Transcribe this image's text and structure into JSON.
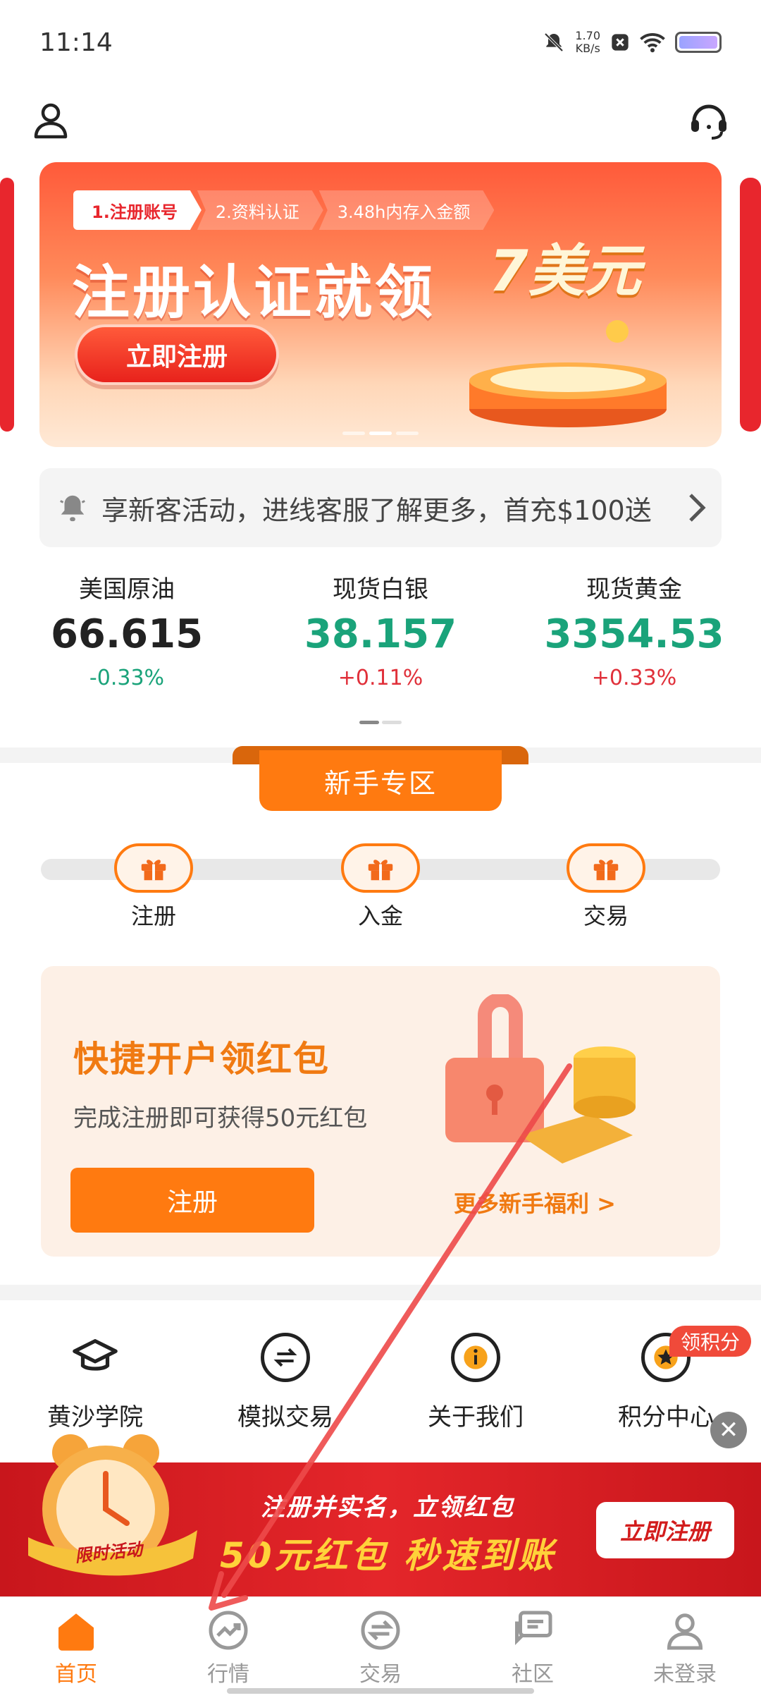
{
  "status_bar": {
    "time": "11:14",
    "net_speed_value": "1.70",
    "net_speed_unit": "KB/s"
  },
  "header": {
    "left_icon": "user-icon",
    "right_icon": "headset-icon"
  },
  "banner": {
    "steps": [
      "1.注册账号",
      "2.资料认证",
      "3.48h内存入金额"
    ],
    "title": "注册认证就领",
    "amount": "7美元",
    "button": "立即注册"
  },
  "notice": {
    "text": "享新客活动，进线客服了解更多，首充$100送"
  },
  "quotes": [
    {
      "name": "美国原油",
      "price": "66.615",
      "change": "-0.33%",
      "price_color": "#222222",
      "change_color": "#1aa37a"
    },
    {
      "name": "现货白银",
      "price": "38.157",
      "change": "+0.11%",
      "price_color": "#1aa37a",
      "change_color": "#e0303a"
    },
    {
      "name": "现货黄金",
      "price": "3354.53",
      "change": "+0.33%",
      "price_color": "#1aa37a",
      "change_color": "#e0303a"
    }
  ],
  "newbie": {
    "title": "新手专区",
    "milestones": [
      "注册",
      "入金",
      "交易"
    ],
    "promo": {
      "title": "快捷开户领红包",
      "subtitle": "完成注册即可获得50元红包",
      "button": "注册",
      "more": "更多新手福利 >"
    }
  },
  "quick_links": [
    {
      "label": "黄沙学院",
      "icon": "graduation-cap-icon"
    },
    {
      "label": "模拟交易",
      "icon": "exchange-icon"
    },
    {
      "label": "关于我们",
      "icon": "info-icon"
    },
    {
      "label": "积分中心",
      "icon": "star-icon"
    }
  ],
  "points_badge": "领积分",
  "ad": {
    "badge": "限时活动",
    "line1": "注册并实名，立领红包",
    "line2": "50元红包  秒速到账",
    "button": "立即注册"
  },
  "bottom_nav": [
    {
      "label": "首页",
      "icon": "home-icon",
      "active": true
    },
    {
      "label": "行情",
      "icon": "chart-trend-icon",
      "active": false
    },
    {
      "label": "交易",
      "icon": "exchange-icon",
      "active": false
    },
    {
      "label": "社区",
      "icon": "chat-icon",
      "active": false
    },
    {
      "label": "未登录",
      "icon": "user-icon",
      "active": false
    }
  ],
  "colors": {
    "accent": "#ff7a10",
    "up": "#e0303a",
    "down": "#1aa37a",
    "ad_red": "#d21c1c"
  }
}
